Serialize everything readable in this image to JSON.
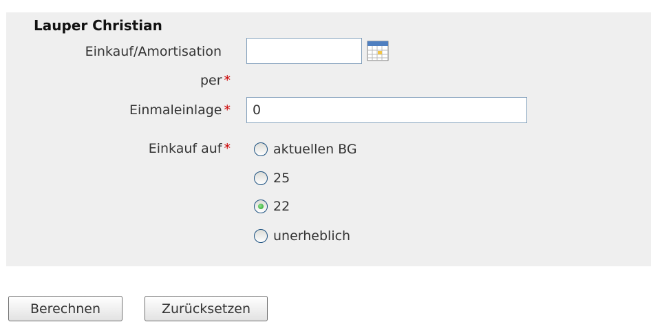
{
  "form": {
    "title": "Lauper Christian",
    "fields": {
      "einkauf_per": {
        "label_line1": "Einkauf/Amortisation",
        "label_line2": "per",
        "required_mark": "*",
        "value": ""
      },
      "einmaleinlage": {
        "label": "Einmaleinlage",
        "required_mark": "*",
        "value": "0"
      },
      "einkauf_auf": {
        "label": "Einkauf auf",
        "required_mark": "*",
        "options": [
          {
            "label": "aktuellen BG",
            "checked": false
          },
          {
            "label": "25",
            "checked": false
          },
          {
            "label": "22",
            "checked": true
          },
          {
            "label": "unerheblich",
            "checked": false
          }
        ]
      }
    }
  },
  "buttons": {
    "calculate": "Berechnen",
    "reset": "Zurücksetzen"
  },
  "icons": {
    "calendar": "calendar-icon"
  }
}
